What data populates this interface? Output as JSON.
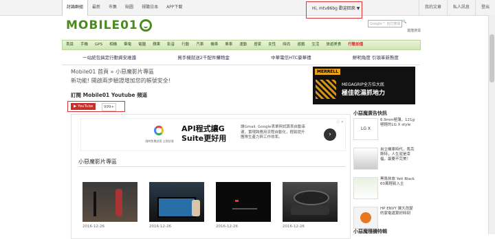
{
  "topbar": {
    "tabs": [
      "討論群組",
      "最新",
      "市集",
      "貼圖",
      "視聽日本",
      "APP下載"
    ],
    "greeting": "Hi, mtv86bg 歡迎回來 ▼",
    "right_links": [
      "我的文章",
      "私人訊息",
      "登出"
    ]
  },
  "logo": {
    "text": "MOBILE01"
  },
  "search": {
    "placeholder": "Google™ 自訂搜尋",
    "advanced": "進階搜尋"
  },
  "nav": {
    "items": [
      "首頁",
      "手機",
      "GPS",
      "相機",
      "筆電",
      "電腦",
      "蘋果",
      "影音",
      "行動",
      "汽車",
      "機車",
      "單車",
      "運動",
      "居家",
      "女性",
      "時尚",
      "遊戲",
      "生活",
      "旅遊美食",
      "活動"
    ],
    "hot_item": "行動加值"
  },
  "ads_row": [
    "一站統包搞定行動資安維護",
    "買手機就送2千配件購物金",
    "中華電信HTC豪華禮",
    "鮮明角度 引領革新態度"
  ],
  "breadcrumb": "Mobile01 首頁 » 小惡魔影片專區",
  "notice": "新功能! 開啟兩步驗證增加您的帳號安全!",
  "subscribe": {
    "title": "訂閱 Mobile01 Youtube 頻道",
    "button": "YouTube",
    "count": "999+"
  },
  "merrell": {
    "brand": "MERRELL",
    "line1": "MEGAGRIP全方位大底",
    "line2": "極佳乾濕抓地力"
  },
  "google_ad": {
    "caption": "限時免費試用 立即註冊",
    "headline": "API程式讓G Suite更好用",
    "description": "讓Gmail, Google表單與試算表自動串連，實現跨應用流程自動化，輕鬆提升團隊生產力與工作效率。",
    "badge": "ⓘ ✕"
  },
  "section": {
    "title": "小惡魔影片專區"
  },
  "videos": [
    {
      "date": "2016-12-26"
    },
    {
      "date": "2016-12-26"
    },
    {
      "date": "2016-12-26"
    },
    {
      "date": "2016-12-26"
    }
  ],
  "sidebar": {
    "heading": "小惡魔廣告快訊",
    "items": [
      {
        "text": "6.9mm極薄，121g極輕的LG X style"
      },
      {
        "text": "自立機車時代，馬克斯特，人生就是幸福，最要不完美！"
      },
      {
        "text": "黑馬休旅 Yeti Black 60萬輕鬆入主"
      },
      {
        "text": "HP ENVY 讓大改變的家電運算好時刻"
      }
    ],
    "heading2": "小惡魔隨機特輯"
  }
}
